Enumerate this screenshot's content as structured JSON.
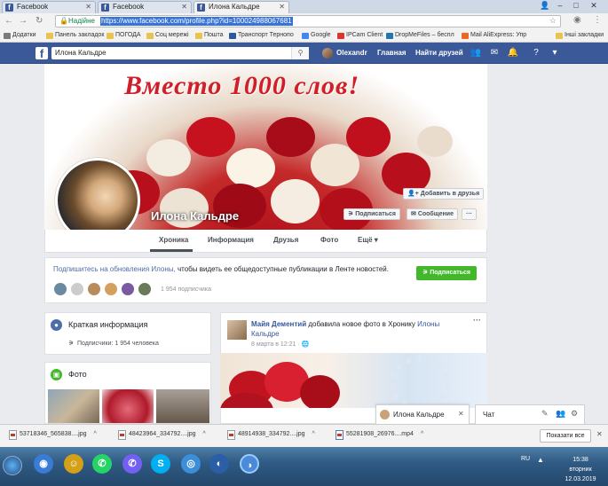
{
  "browser": {
    "tabs": [
      {
        "title": "Facebook"
      },
      {
        "title": "Facebook"
      },
      {
        "title": "Илона Кальдре"
      }
    ],
    "window_controls": {
      "user": "👤",
      "minimize": "–",
      "maximize": "□",
      "close": "✕"
    },
    "address": {
      "security": "Надійне",
      "url": "https://www.facebook.com/profile.php?id=100024988067681"
    },
    "bookmarks": [
      "Додатки",
      "Панель закладок",
      "ПОГОДА",
      "Соц мережі",
      "Пошта",
      "Транспорт Тернопо",
      "Google",
      "IPCam Client",
      "DropMeFiles – беспл",
      "Mail AliExpress: Упр",
      "Інші закладки"
    ]
  },
  "fb_header": {
    "search_value": "Илона Кальдре",
    "user_name": "Olexandr",
    "home": "Главная",
    "find_friends": "Найти друзей"
  },
  "profile": {
    "cover_text": "Вместо 1000 слов!",
    "name": "Илона Кальдре",
    "add_friend": "Добавить в друзья",
    "follow": "Подписаться",
    "message": "Сообщение",
    "more": "···"
  },
  "profile_tabs": [
    {
      "label": "Хроника"
    },
    {
      "label": "Информация"
    },
    {
      "label": "Друзья"
    },
    {
      "label": "Фото"
    },
    {
      "label": "Ещё ▾"
    }
  ],
  "subscribe": {
    "link_text": "Подпишитесь на обновления Илоны,",
    "rest_text": " чтобы видеть ее общедоступные публикации в Ленте новостей.",
    "button": "Подписаться",
    "count": "1 954 подписчика"
  },
  "intro": {
    "title": "Краткая информация",
    "followers": "Подписчики: 1 954 человека"
  },
  "photos": {
    "title": "Фото"
  },
  "post": {
    "author": "Майя Дементий",
    "action": "добавила новое фото в Хронику",
    "target_1": "Илоны",
    "target_2": "Кальдре",
    "date": "8 марта в 12:21 · 🌐",
    "menu": "···"
  },
  "chat": {
    "tab_name": "Илона Кальдре",
    "sidebar_label": "Чат"
  },
  "downloads": {
    "items": [
      "53718346_565838....jpg",
      "48423964_334792....jpg",
      "48914938_334792....jpg",
      "55281908_26976....mp4"
    ],
    "show_all": "Показати все"
  },
  "taskbar": {
    "lang": "RU",
    "time": "15:38",
    "day": "вторник",
    "date": "12.03.2019"
  }
}
